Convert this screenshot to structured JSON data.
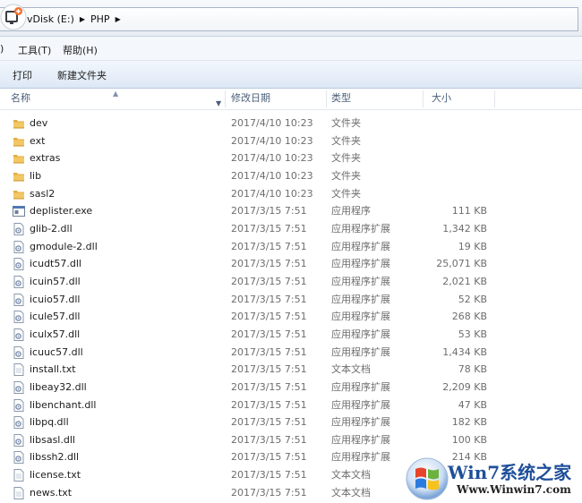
{
  "address": {
    "crumbs": [
      "vDisk (E:)",
      "PHP"
    ],
    "sep_glyph": "▶"
  },
  "menu": {
    "leading_fragment": ")",
    "tools": "工具(T)",
    "help": "帮助(H)"
  },
  "toolbar": {
    "print": "打印",
    "new_folder": "新建文件夹"
  },
  "columns": {
    "name": "名称",
    "date": "修改日期",
    "type": "类型",
    "size": "大小"
  },
  "files": [
    {
      "name": "dev",
      "date": "2017/4/10 10:23",
      "type": "文件夹",
      "size": "",
      "icon": "folder-icon"
    },
    {
      "name": "ext",
      "date": "2017/4/10 10:23",
      "type": "文件夹",
      "size": "",
      "icon": "folder-icon"
    },
    {
      "name": "extras",
      "date": "2017/4/10 10:23",
      "type": "文件夹",
      "size": "",
      "icon": "folder-icon"
    },
    {
      "name": "lib",
      "date": "2017/4/10 10:23",
      "type": "文件夹",
      "size": "",
      "icon": "folder-icon"
    },
    {
      "name": "sasl2",
      "date": "2017/4/10 10:23",
      "type": "文件夹",
      "size": "",
      "icon": "folder-icon"
    },
    {
      "name": "deplister.exe",
      "date": "2017/3/15 7:51",
      "type": "应用程序",
      "size": "111 KB",
      "icon": "exe-icon"
    },
    {
      "name": "glib-2.dll",
      "date": "2017/3/15 7:51",
      "type": "应用程序扩展",
      "size": "1,342 KB",
      "icon": "dll-icon"
    },
    {
      "name": "gmodule-2.dll",
      "date": "2017/3/15 7:51",
      "type": "应用程序扩展",
      "size": "19 KB",
      "icon": "dll-icon"
    },
    {
      "name": "icudt57.dll",
      "date": "2017/3/15 7:51",
      "type": "应用程序扩展",
      "size": "25,071 KB",
      "icon": "dll-icon"
    },
    {
      "name": "icuin57.dll",
      "date": "2017/3/15 7:51",
      "type": "应用程序扩展",
      "size": "2,021 KB",
      "icon": "dll-icon"
    },
    {
      "name": "icuio57.dll",
      "date": "2017/3/15 7:51",
      "type": "应用程序扩展",
      "size": "52 KB",
      "icon": "dll-icon"
    },
    {
      "name": "icule57.dll",
      "date": "2017/3/15 7:51",
      "type": "应用程序扩展",
      "size": "268 KB",
      "icon": "dll-icon"
    },
    {
      "name": "iculx57.dll",
      "date": "2017/3/15 7:51",
      "type": "应用程序扩展",
      "size": "53 KB",
      "icon": "dll-icon"
    },
    {
      "name": "icuuc57.dll",
      "date": "2017/3/15 7:51",
      "type": "应用程序扩展",
      "size": "1,434 KB",
      "icon": "dll-icon"
    },
    {
      "name": "install.txt",
      "date": "2017/3/15 7:51",
      "type": "文本文档",
      "size": "78 KB",
      "icon": "txt-icon"
    },
    {
      "name": "libeay32.dll",
      "date": "2017/3/15 7:51",
      "type": "应用程序扩展",
      "size": "2,209 KB",
      "icon": "dll-icon"
    },
    {
      "name": "libenchant.dll",
      "date": "2017/3/15 7:51",
      "type": "应用程序扩展",
      "size": "47 KB",
      "icon": "dll-icon"
    },
    {
      "name": "libpq.dll",
      "date": "2017/3/15 7:51",
      "type": "应用程序扩展",
      "size": "182 KB",
      "icon": "dll-icon"
    },
    {
      "name": "libsasl.dll",
      "date": "2017/3/15 7:51",
      "type": "应用程序扩展",
      "size": "100 KB",
      "icon": "dll-icon"
    },
    {
      "name": "libssh2.dll",
      "date": "2017/3/15 7:51",
      "type": "应用程序扩展",
      "size": "214 KB",
      "icon": "dll-icon"
    },
    {
      "name": "license.txt",
      "date": "2017/3/15 7:51",
      "type": "文本文档",
      "size": "",
      "icon": "txt-icon"
    },
    {
      "name": "news.txt",
      "date": "2017/3/15 7:51",
      "type": "文本文档",
      "size": "",
      "icon": "txt-icon"
    }
  ],
  "watermark": {
    "brand": "Win7系统之家",
    "url": "Www.Winwin7.com"
  },
  "colors": {
    "folder": "#e8b64a",
    "header_text": "#4c607a",
    "watermark_blue": "#1f4f9a"
  }
}
